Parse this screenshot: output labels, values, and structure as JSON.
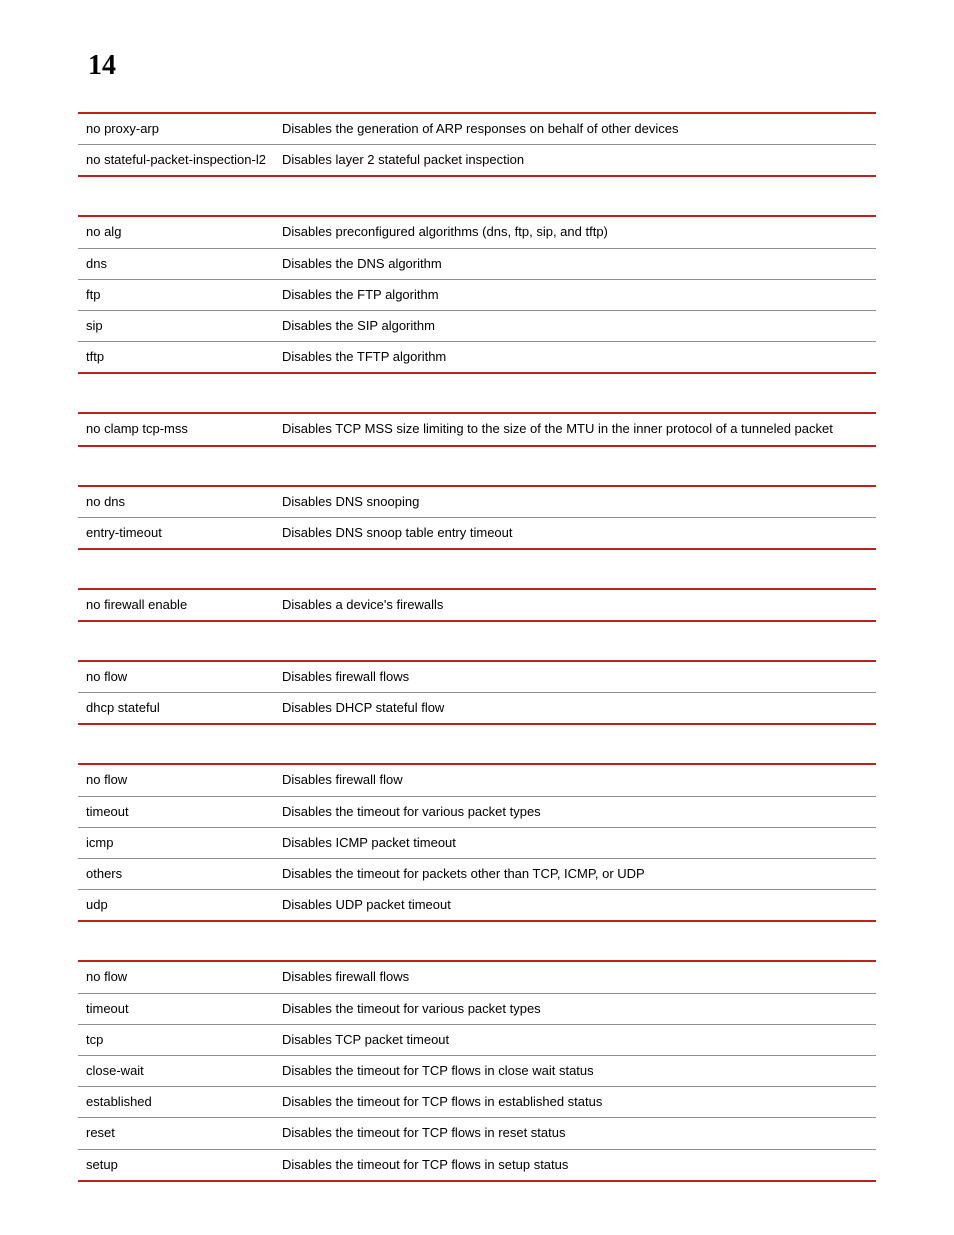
{
  "page_number": "14",
  "tables": [
    {
      "rows": [
        {
          "param": "no proxy-arp",
          "desc": "Disables the generation of ARP responses on behalf of other devices"
        },
        {
          "param": "no stateful-packet-inspection-l2",
          "desc": "Disables layer 2 stateful packet inspection"
        }
      ]
    },
    {
      "rows": [
        {
          "param": "no alg",
          "desc": "Disables preconfigured algorithms (dns, ftp, sip, and tftp)"
        },
        {
          "param": "dns",
          "desc": "Disables the DNS algorithm"
        },
        {
          "param": "ftp",
          "desc": "Disables the FTP algorithm"
        },
        {
          "param": "sip",
          "desc": "Disables the SIP algorithm"
        },
        {
          "param": "tftp",
          "desc": "Disables the TFTP algorithm"
        }
      ]
    },
    {
      "rows": [
        {
          "param": "no clamp tcp-mss",
          "desc": "Disables TCP MSS size limiting to the size of the MTU in the inner protocol of a tunneled packet"
        }
      ]
    },
    {
      "rows": [
        {
          "param": "no dns",
          "desc": "Disables DNS snooping"
        },
        {
          "param": "entry-timeout",
          "desc": "Disables DNS snoop table entry timeout"
        }
      ]
    },
    {
      "rows": [
        {
          "param": "no firewall enable",
          "desc": "Disables a device's firewalls"
        }
      ]
    },
    {
      "rows": [
        {
          "param": "no flow",
          "desc": "Disables firewall flows"
        },
        {
          "param": "dhcp stateful",
          "desc": "Disables DHCP stateful flow"
        }
      ]
    },
    {
      "rows": [
        {
          "param": "no flow",
          "desc": "Disables firewall flow"
        },
        {
          "param": "timeout",
          "desc": "Disables the timeout for various packet types"
        },
        {
          "param": "icmp",
          "desc": "Disables ICMP packet timeout"
        },
        {
          "param": "others",
          "desc": "Disables the timeout for packets other than TCP, ICMP, or UDP"
        },
        {
          "param": "udp",
          "desc": "Disables UDP packet timeout"
        }
      ]
    },
    {
      "rows": [
        {
          "param": "no flow",
          "desc": "Disables firewall flows"
        },
        {
          "param": "timeout",
          "desc": "Disables the timeout for various packet types"
        },
        {
          "param": "tcp",
          "desc": "Disables TCP packet timeout"
        },
        {
          "param": "close-wait",
          "desc": "Disables the timeout for TCP flows in close wait status"
        },
        {
          "param": "established",
          "desc": "Disables the timeout for TCP flows in established status"
        },
        {
          "param": "reset",
          "desc": "Disables the timeout for TCP flows in reset status"
        },
        {
          "param": "setup",
          "desc": "Disables the timeout for TCP flows in setup status"
        }
      ]
    }
  ]
}
